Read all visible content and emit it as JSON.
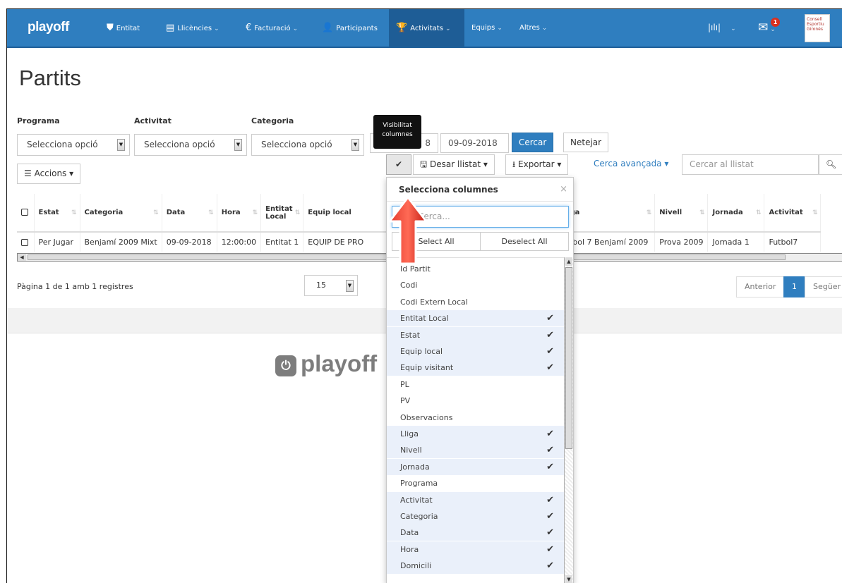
{
  "nav": {
    "brand": "playoff",
    "items": [
      {
        "label": "Entitat",
        "icon": "shield-icon",
        "glyph": "⛊"
      },
      {
        "label": "Llicències",
        "icon": "id-card-icon",
        "glyph": "▤"
      },
      {
        "label": "Facturació",
        "icon": "euro-icon",
        "glyph": "€"
      },
      {
        "label": "Participants",
        "icon": "user-icon",
        "glyph": "👤"
      },
      {
        "label": "Activitats",
        "icon": "trophy-icon",
        "glyph": "🏆"
      },
      {
        "label": "Equips",
        "icon": "",
        "glyph": ""
      },
      {
        "label": "Altres",
        "icon": "",
        "glyph": ""
      }
    ],
    "chart_glyph": "|ılı|",
    "notif_count": "1",
    "org_logo_text": "Consell Esportiu Gironès",
    "accent": "#2f7ebf"
  },
  "page": {
    "title": "Partits"
  },
  "filters": {
    "programa_label": "Programa",
    "activitat_label": "Activitat",
    "categoria_label": "Categoria",
    "programa_value": "Selecciona opció",
    "activitat_value": "Selecciona opció",
    "categoria_value": "Selecciona opció",
    "date_from_partial": "8",
    "date_to": "09-09-2018",
    "search_button": "Cercar",
    "clear_button": "Netejar"
  },
  "toolbar": {
    "actions": "Accions",
    "save_list": "Desar llistat",
    "export": "Exportar",
    "advanced_search": "Cerca avançada",
    "search_placeholder": "Cercar al llistat"
  },
  "tooltip": {
    "line1": "Visibilitat",
    "line2": "columnes"
  },
  "table": {
    "headers": [
      "Estat",
      "Categoria",
      "Data",
      "Hora",
      "Entitat Local",
      "Equip local",
      "Lliga",
      "Nivell",
      "Jornada",
      "Activitat"
    ],
    "rows": [
      [
        "Per Jugar",
        "Benjamí 2009 Mixt",
        "09-09-2018",
        "12:00:00",
        "Entitat 1",
        "EQUIP DE PRO",
        "Futbol 7 Benjamí 2009",
        "Prova 2009",
        "Jornada 1",
        "Futbol7"
      ]
    ]
  },
  "pagination": {
    "info": "Pàgina 1 de 1 amb 1 registres",
    "page_size": "15",
    "prev": "Anterior",
    "current": "1",
    "next": "Següer"
  },
  "watermark": "playoff",
  "column_picker": {
    "title": "Selecciona columnes",
    "search_placeholder": "Cerca...",
    "select_all": "Select All",
    "deselect_all": "Deselect All",
    "items": [
      {
        "label": "Id Partit",
        "checked": false
      },
      {
        "label": "Codi",
        "checked": false
      },
      {
        "label": "Codi Extern Local",
        "checked": false
      },
      {
        "label": "Entitat Local",
        "checked": true
      },
      {
        "label": "Estat",
        "checked": true
      },
      {
        "label": "Equip local",
        "checked": true
      },
      {
        "label": "Equip visitant",
        "checked": true
      },
      {
        "label": "PL",
        "checked": false
      },
      {
        "label": "PV",
        "checked": false
      },
      {
        "label": "Observacions",
        "checked": false
      },
      {
        "label": "Lliga",
        "checked": true
      },
      {
        "label": "Nivell",
        "checked": true
      },
      {
        "label": "Jornada",
        "checked": true
      },
      {
        "label": "Programa",
        "checked": false
      },
      {
        "label": "Activitat",
        "checked": true
      },
      {
        "label": "Categoria",
        "checked": true
      },
      {
        "label": "Data",
        "checked": true
      },
      {
        "label": "Hora",
        "checked": true
      },
      {
        "label": "Domicili",
        "checked": true
      }
    ]
  }
}
